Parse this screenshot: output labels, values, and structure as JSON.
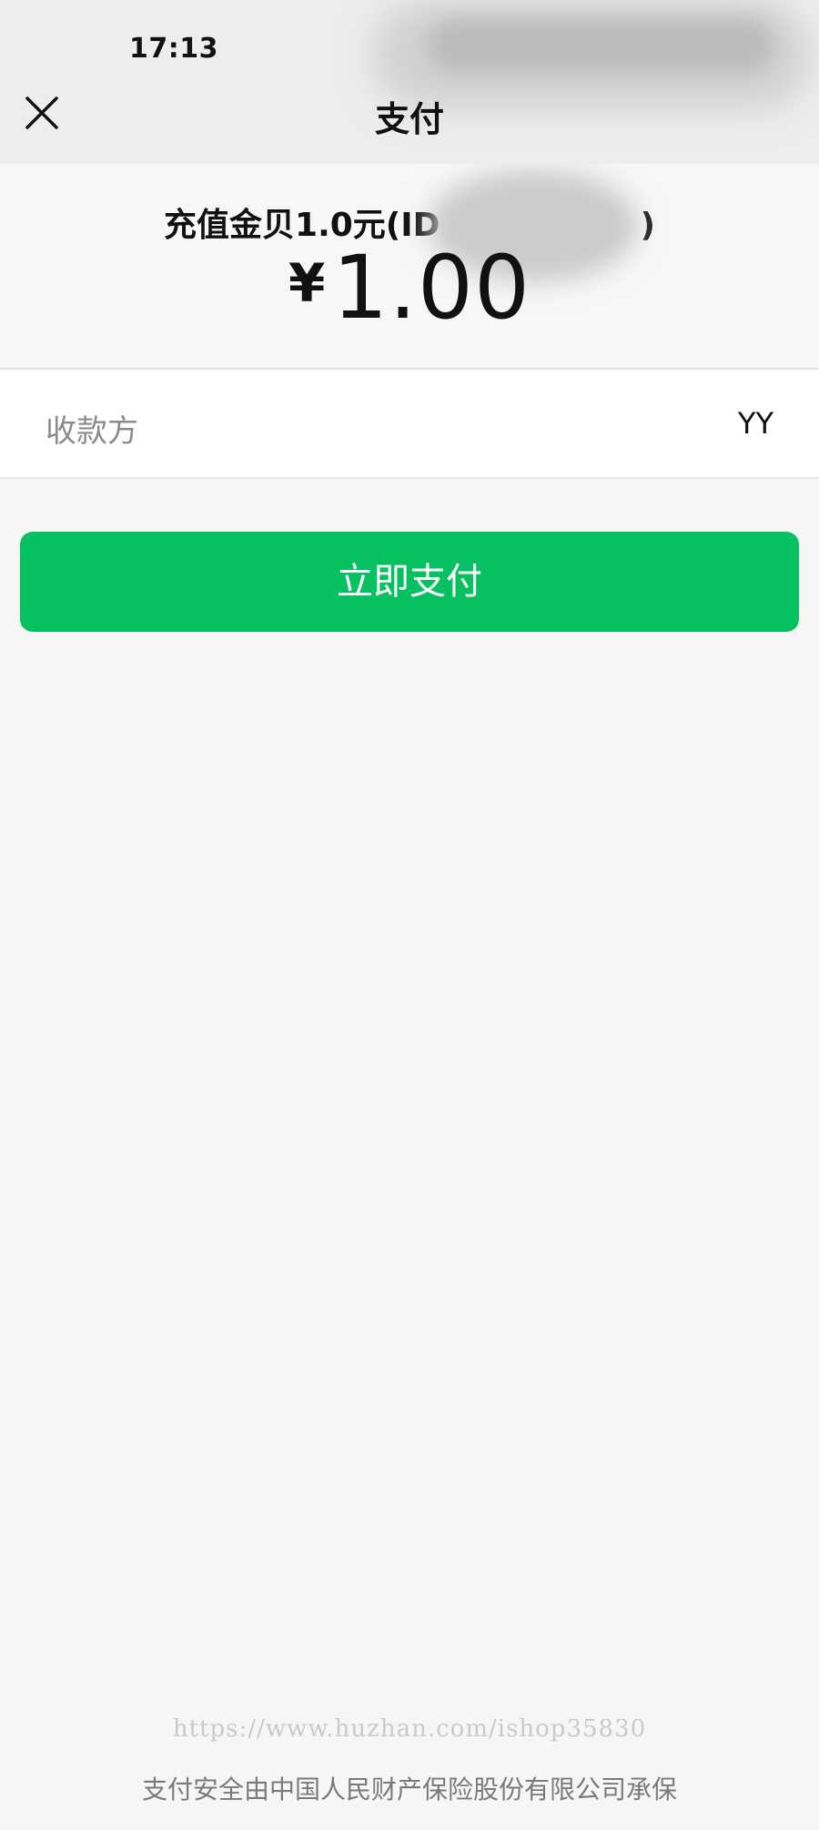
{
  "status_bar": {
    "time": "17:13"
  },
  "nav": {
    "title": "支付",
    "close_icon": "close-icon"
  },
  "order": {
    "title": "充值金贝1.0元(ID",
    "title_suffix": ")",
    "currency": "¥",
    "amount": "1.00"
  },
  "payee": {
    "label": "收款方",
    "value": "YY"
  },
  "actions": {
    "pay_label": "立即支付"
  },
  "footer": {
    "watermark": "https://www.huzhan.com/ishop35830",
    "insurance_note": "支付安全由中国人民财产保险股份有限公司承保"
  },
  "colors": {
    "primary_green": "#07c160",
    "page_background": "#f6f6f6"
  }
}
